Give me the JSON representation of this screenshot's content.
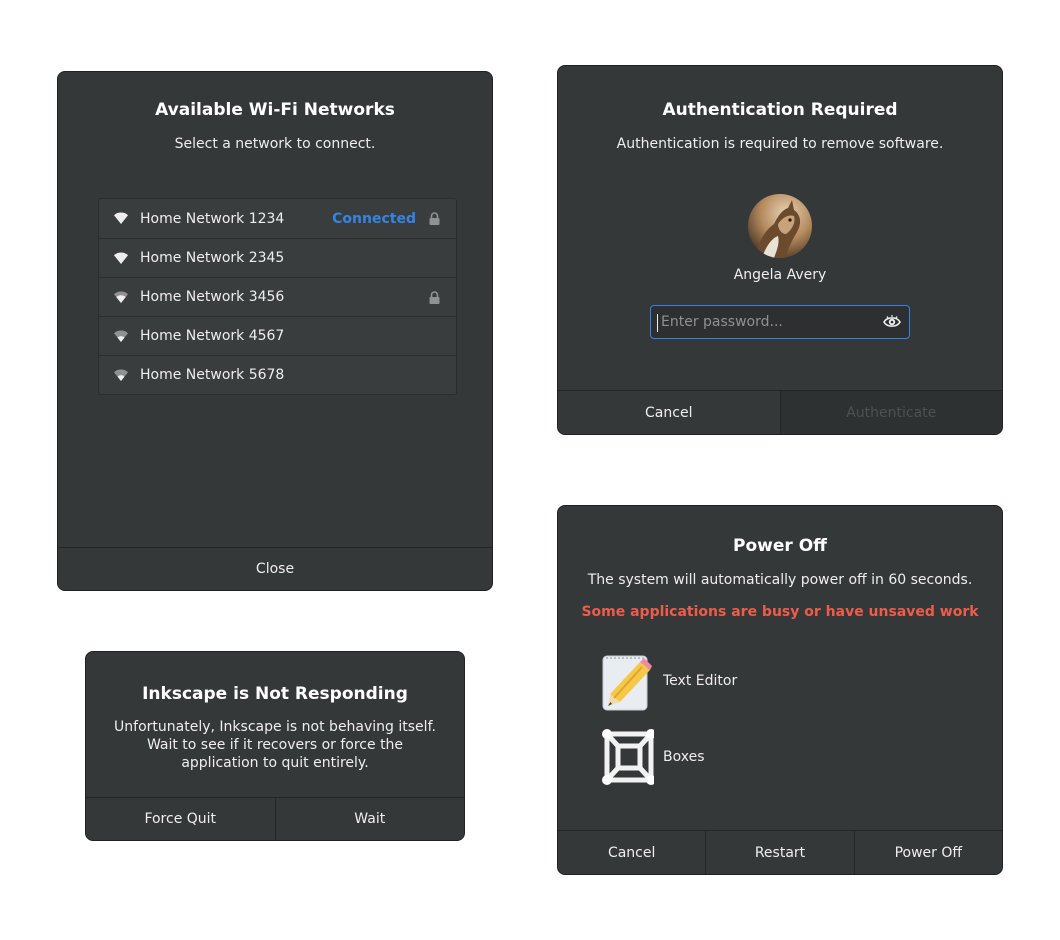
{
  "wifi_dialog": {
    "title": "Available Wi-Fi Networks",
    "subtitle": "Select a network to connect.",
    "networks": [
      {
        "name": "Home Network 1234",
        "status": "Connected",
        "locked": true,
        "signal": "full"
      },
      {
        "name": "Home Network 2345",
        "status": "",
        "locked": false,
        "signal": "full"
      },
      {
        "name": "Home Network 3456",
        "status": "",
        "locked": true,
        "signal": "high"
      },
      {
        "name": "Home Network 4567",
        "status": "",
        "locked": false,
        "signal": "medium"
      },
      {
        "name": "Home Network 5678",
        "status": "",
        "locked": false,
        "signal": "medium"
      }
    ],
    "close_label": "Close"
  },
  "auth_dialog": {
    "title": "Authentication Required",
    "subtitle": "Authentication is required to remove software.",
    "user_name": "Angela Avery",
    "password_placeholder": "Enter password...",
    "cancel_label": "Cancel",
    "authenticate_label": "Authenticate"
  },
  "inkscape_dialog": {
    "title": "Inkscape is Not Responding",
    "message_lines": [
      "Unfortunately, Inkscape is not behaving itself.",
      "Wait to see if it recovers or force the",
      "application to quit entirely."
    ],
    "force_quit_label": "Force Quit",
    "wait_label": "Wait"
  },
  "power_dialog": {
    "title": "Power Off",
    "subtitle": "The system will automatically power off in 60 seconds.",
    "warning": "Some applications are busy or have unsaved work",
    "apps": [
      {
        "name": "Text Editor",
        "icon": "text-editor-icon"
      },
      {
        "name": "Boxes",
        "icon": "boxes-icon"
      }
    ],
    "cancel_label": "Cancel",
    "restart_label": "Restart",
    "power_off_label": "Power Off"
  },
  "colors": {
    "dialog_bg": "#353839",
    "accent": "#3584e4",
    "warning": "#ee5c4a"
  }
}
